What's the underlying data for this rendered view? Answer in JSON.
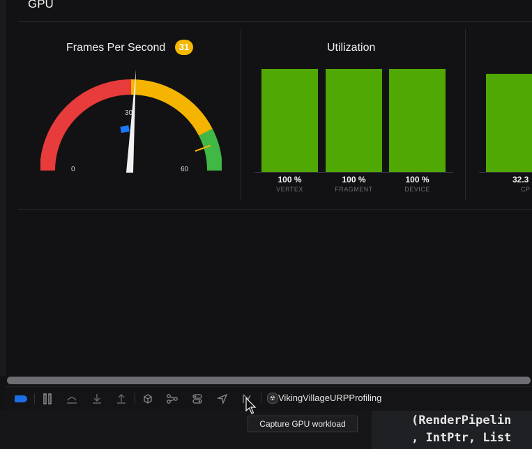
{
  "section": {
    "title": "GPU"
  },
  "fps_panel": {
    "title": "Frames Per Second",
    "badge_value": "31",
    "gauge": {
      "min_label": "0",
      "mid_label": "30",
      "max_label": "60",
      "value": 31,
      "min": 0,
      "max": 60,
      "colors": {
        "low": "#e83b3b",
        "mid": "#f5b400",
        "high": "#3fb845",
        "needle": "#f2f2f2",
        "marker": "#1a7aff"
      }
    }
  },
  "utilization_panel": {
    "title": "Utilization",
    "bars": [
      {
        "label": "VERTEX",
        "value_text": "100 %",
        "value": 100
      },
      {
        "label": "FRAGMENT",
        "value_text": "100 %",
        "value": 100
      },
      {
        "label": "DEVICE",
        "value_text": "100 %",
        "value": 100
      }
    ],
    "bar_color": "#4fa804"
  },
  "partial_panel": {
    "value_text": "32.3",
    "label": "CP"
  },
  "toolbar": {
    "icons": [
      "breakpoint-toggle-icon",
      "pause-icon",
      "step-over-icon",
      "step-into-icon",
      "step-out-icon",
      "view-hierarchy-icon",
      "memory-graph-icon",
      "environment-overrides-icon",
      "simulate-location-icon",
      "capture-gpu-workload-icon"
    ],
    "app_name": "VikingVillageURPProfiling"
  },
  "tooltip": {
    "text": "Capture GPU workload"
  },
  "code": {
    "line1": "(RenderPipelin",
    "line2": ", IntPtr, List"
  }
}
